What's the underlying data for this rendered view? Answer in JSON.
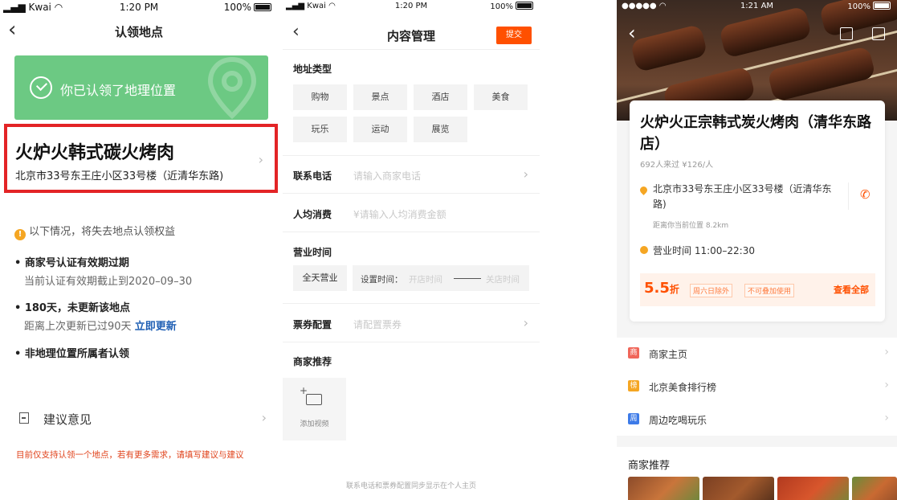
{
  "screen1": {
    "status": {
      "carrier": "Kwai",
      "time": "1:20 PM",
      "battery": "100%"
    },
    "title": "认领地点",
    "banner_text": "你已认领了地理位置",
    "place": {
      "name": "火炉火韩式碳火烤肉",
      "address": "北京市33号东王庄小区33号楼（近清华东路)"
    },
    "notice": "以下情况，将失去地点认领权益",
    "rules": [
      {
        "title": "• 商家号认证有效期过期",
        "desc": "当前认证有效期截止到2020–09–30"
      },
      {
        "title": "• 180天，未更新该地点",
        "desc": "距离上次更新已过90天",
        "link": "立即更新"
      },
      {
        "title": "• 非地理位置所属者认领"
      }
    ],
    "feedback_label": "建议意见",
    "hint": "目前仅支持认领一个地点，若有更多需求，请填写建议与建议"
  },
  "screen2": {
    "status": {
      "carrier": "Kwai",
      "time": "1:20 PM",
      "battery": "100%"
    },
    "title": "内容管理",
    "submit": "提交",
    "address_type_label": "地址类型",
    "types": [
      "购物",
      "景点",
      "酒店",
      "美食",
      "玩乐",
      "运动",
      "展览"
    ],
    "phone_label": "联系电话",
    "phone_placeholder": "请输入商家电话",
    "price_label": "人均消费",
    "price_placeholder": "¥请输入人均消费金额",
    "hours_label": "营业时间",
    "allday": "全天营业",
    "set_time": "设置时间：",
    "open_time": "开店时间",
    "close_time": "关店时间",
    "ticket_label": "票券配置",
    "ticket_placeholder": "请配置票券",
    "rec_label": "商家推荐",
    "add_video": "添加视频",
    "footer": "联系电话和票券配置同步显示在个人主页"
  },
  "screen3": {
    "status": {
      "signal": "●●●●●",
      "time": "1:21 AM",
      "battery": "100%"
    },
    "name": "火炉火正宗韩式炭火烤肉（清华东路店）",
    "meta": "692人来过  ¥126/人",
    "address": "北京市33号东王庄小区33号楼（近清华东路)",
    "distance": "距离你当前位置 8.2km",
    "hours": "营业时间  11:00–22:30",
    "discount_num": "5.5",
    "discount_unit": "折",
    "tag1": "周六日除外",
    "tag2": "不可叠加使用",
    "view_all": "查看全部",
    "links": [
      {
        "icon": "商",
        "label": "商家主页",
        "color": "#f0665a"
      },
      {
        "icon": "榜",
        "label": "北京美食排行榜",
        "color": "#f5a623"
      },
      {
        "icon": "周",
        "label": "周边吃喝玩乐",
        "color": "#3d7be8"
      }
    ],
    "rec_label": "商家推荐"
  }
}
